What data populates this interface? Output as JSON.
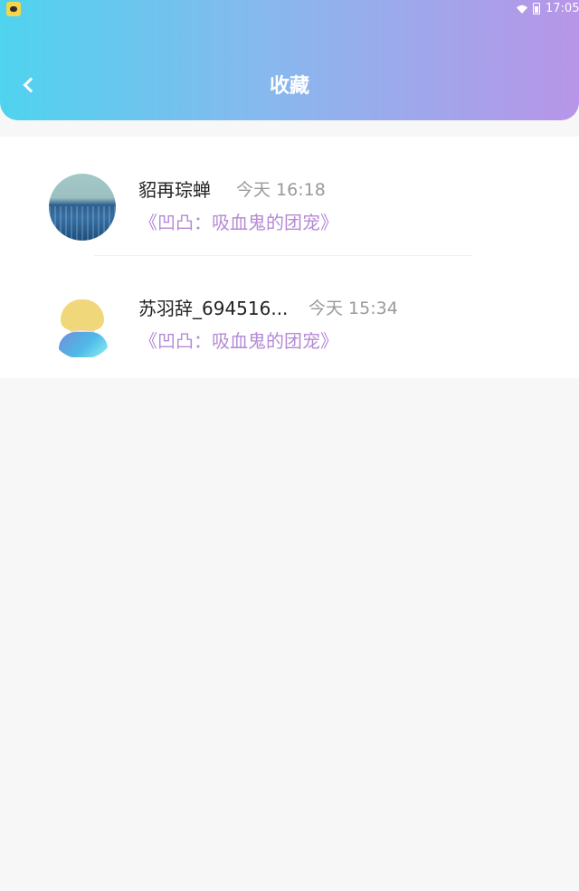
{
  "status_bar": {
    "time": "17:05"
  },
  "header": {
    "title": "收藏"
  },
  "favorites": [
    {
      "name": "貂再琮蝉",
      "time": "今天 16:18",
      "book": "《凹凸：吸血鬼的团宠》"
    },
    {
      "name": "苏羽辞_694516...",
      "time": "今天 15:34",
      "book": "《凹凸：吸血鬼的团宠》"
    }
  ],
  "colors": {
    "header_start": "#4fd3ef",
    "header_end": "#b895e8",
    "book_title": "#b48ad6",
    "time_text": "#9a9a9a"
  }
}
